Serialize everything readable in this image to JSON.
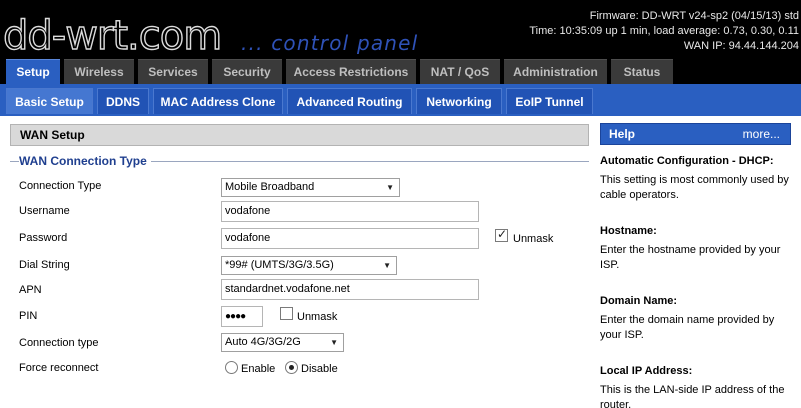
{
  "header": {
    "logo_text": "dd-wrt.com",
    "panel_title": "... control panel",
    "firmware": "Firmware: DD-WRT v24-sp2 (04/15/13) std",
    "time": "Time: 10:35:09 up 1 min, load average: 0.73, 0.30, 0.11",
    "wan_ip": "WAN IP: 94.44.144.204"
  },
  "main_tabs": [
    "Setup",
    "Wireless",
    "Services",
    "Security",
    "Access Restrictions",
    "NAT / QoS",
    "Administration",
    "Status"
  ],
  "sub_tabs": [
    "Basic Setup",
    "DDNS",
    "MAC Address Clone",
    "Advanced Routing",
    "Networking",
    "EoIP Tunnel"
  ],
  "section": {
    "title": "WAN Setup",
    "legend": "WAN Connection Type"
  },
  "form": {
    "connection_type_label": "Connection Type",
    "connection_type_value": "Mobile Broadband",
    "username_label": "Username",
    "username_value": "vodafone",
    "password_label": "Password",
    "password_value": "vodafone",
    "unmask_label": "Unmask",
    "dial_string_label": "Dial String",
    "dial_string_value": "*99# (UMTS/3G/3.5G)",
    "apn_label": "APN",
    "apn_value": "standardnet.vodafone.net",
    "pin_label": "PIN",
    "pin_value": "●●●●",
    "pin_unmask_label": "Unmask",
    "conn_type2_label": "Connection type",
    "conn_type2_value": "Auto 4G/3G/2G",
    "force_reconnect_label": "Force reconnect",
    "enable_label": "Enable",
    "disable_label": "Disable"
  },
  "help": {
    "title": "Help",
    "more": "more...",
    "items": [
      {
        "heading": "Automatic Configuration - DHCP:",
        "text": "This setting is most commonly used by cable operators."
      },
      {
        "heading": "Hostname:",
        "text": "Enter the hostname provided by your ISP."
      },
      {
        "heading": "Domain Name:",
        "text": "Enter the domain name provided by your ISP."
      },
      {
        "heading": "Local IP Address:",
        "text": "This is the LAN-side IP address of the router."
      }
    ]
  },
  "colors": {
    "accent": "#2a5fc1",
    "header_bg": "#000000"
  }
}
